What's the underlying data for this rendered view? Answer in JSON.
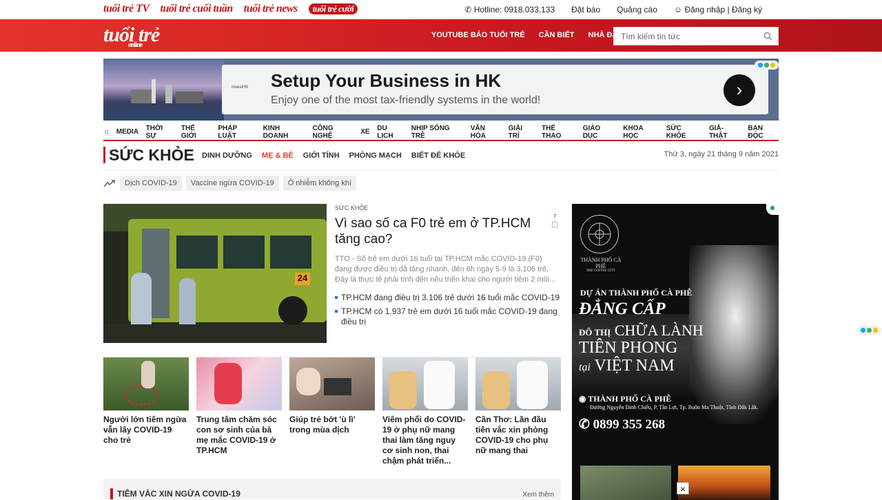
{
  "topbar": {
    "brands": [
      "tuổi trẻ TV",
      "tuổi trẻ cuối tuần",
      "tuổi trẻ news",
      "tuổi trẻ cười"
    ],
    "hotline": "Hotline: 0918.033.133",
    "subscribe": "Đặt báo",
    "advertise": "Quảng cáo",
    "login": "Đăng nhập | Đăng ký"
  },
  "header": {
    "logo": "tuổi trẻ",
    "logo_sub": "online",
    "links": [
      "YOUTUBE BÁO TUỔI TRẺ",
      "CẦN BIẾT",
      "NHÀ ĐẤT"
    ],
    "search_placeholder": "Tìm kiếm tin tức"
  },
  "banner_ad": {
    "title": "Setup Your Business in HK",
    "subtitle": "Enjoy one of the most tax-friendly systems in the world!",
    "logo_text": "InvestHK"
  },
  "main_nav": [
    "MEDIA",
    "THỜI SỰ",
    "THẾ GIỚI",
    "PHÁP LUẬT",
    "KINH DOANH",
    "CÔNG NGHỆ",
    "XE",
    "DU LỊCH",
    "NHỊP SỐNG TRẺ",
    "VĂN HÓA",
    "GIẢI TRÍ",
    "THỂ THAO",
    "GIÁO DỤC",
    "KHOA HỌC",
    "SỨC KHỎE",
    "GIẢ-THẬT",
    "BẠN ĐỌC"
  ],
  "category": {
    "name": "SỨC KHỎE",
    "subnav": [
      "DINH DƯỠNG",
      "MẸ & BÉ",
      "GIỚI TÍNH",
      "PHÒNG MẠCH",
      "BIẾT ĐỂ KHỎE"
    ],
    "active_sub": "MẸ & BÉ",
    "date": "Thứ 3, ngày 21 tháng 9 năm 2021"
  },
  "trending": [
    "Dịch COVID-19",
    "Vaccine ngừa COVID-19",
    "Ô nhiễm không khí"
  ],
  "lead": {
    "tag": "SỨC KHỎE",
    "title": "Vì sao số ca F0 trẻ em ở TP.HCM tăng cao?",
    "comments": "7",
    "sapo": "TTO - Số trẻ em dưới 16 tuổi tại TP.HCM mắc COVID-19 (F0) đang được điều trị đã tăng nhanh, đến 6h ngày 5-9 là 3.106 trẻ. Đây là thực tế phải tính đến nếu triển khai cho người tiêm 2 mũi...",
    "related": [
      "TP.HCM đang điều trị 3.106 trẻ dưới 16 tuổi mắc COVID-19",
      "TP.HCM có 1.937 trẻ em dưới 16 tuổi mắc COVID-19 đang điều trị"
    ],
    "bus_number": "24"
  },
  "stories": [
    "Người lớn tiêm ngừa vẫn lây COVID-19 cho trẻ",
    "Trung tâm chăm sóc con sơ sinh của bà mẹ mắc COVID-19 ở TP.HCM",
    "Giúp trẻ bớt 'ù lì' trong mùa dịch",
    "Viêm phổi do COVID-19 ở phụ nữ mang thai làm tăng nguy cơ sinh non, thai chậm phát triển...",
    "Cần Thơ: Lần đầu tiên vắc xin phòng COVID-19 cho phụ nữ mang thai"
  ],
  "vaccine_box": {
    "title": "TIÊM VẮC XIN NGỪA COVID-19",
    "more": "Xem thêm"
  },
  "side_ad": {
    "logo_caption": "THÀNH PHỐ CÀ PHÊ",
    "logo_caption_en": "THE COFFEE CITY",
    "project": "DỰ ÁN THÀNH PHỐ CÀ PHÊ",
    "line1": "ĐẲNG CẤP",
    "line2_prefix": "ĐÔ THỊ",
    "line2": "CHỮA LÀNH",
    "line3": "TIÊN PHONG",
    "line4_prefix": "tại",
    "line4": "VIỆT NAM",
    "brand": "THÀNH PHỐ CÀ PHÊ",
    "address": "Đường Nguyễn Đình Chiểu, P. Tân Lợi, Tp. Buôn Ma Thuột, Tỉnh Đắk Lắk.",
    "phone": "0899 355 268"
  },
  "colors": {
    "brand_red": "#c4161c",
    "active": "#e43d30"
  }
}
